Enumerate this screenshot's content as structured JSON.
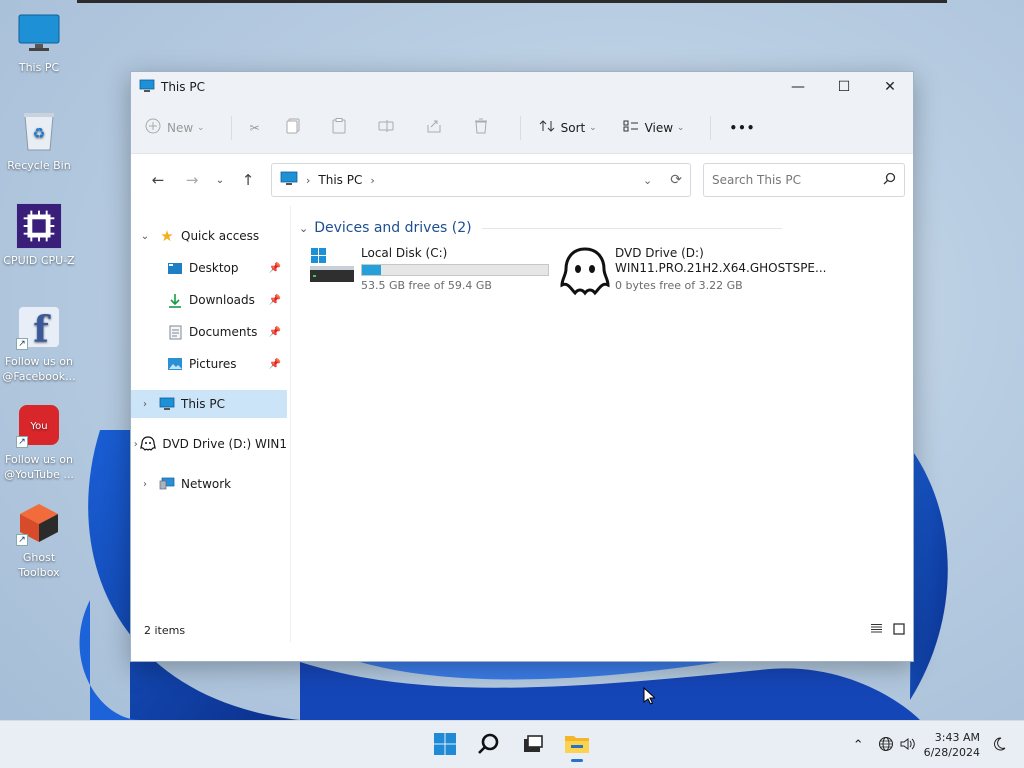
{
  "desktop": {
    "icons": [
      {
        "label": "This PC",
        "icon": "monitor-icon"
      },
      {
        "label": "Recycle Bin",
        "icon": "recycle-bin-icon"
      },
      {
        "label": "CPUID CPU-Z",
        "icon": "cpu-z-icon"
      },
      {
        "label": "Follow us on @Facebook...",
        "icon": "facebook-icon"
      },
      {
        "label": "Follow us on @YouTube ...",
        "icon": "youtube-icon"
      },
      {
        "label": "Ghost Toolbox",
        "icon": "ghost-toolbox-icon"
      }
    ]
  },
  "window": {
    "title": "This PC",
    "toolbar": {
      "new_label": "New",
      "sort_label": "Sort",
      "view_label": "View",
      "more_label": "•••"
    },
    "address": {
      "crumb": "This PC",
      "search_placeholder": "Search This PC"
    },
    "nav": {
      "quick_access": "Quick access",
      "items": [
        {
          "label": "Desktop",
          "icon": "desktop-icon"
        },
        {
          "label": "Downloads",
          "icon": "downloads-icon"
        },
        {
          "label": "Documents",
          "icon": "documents-icon"
        },
        {
          "label": "Pictures",
          "icon": "pictures-icon"
        }
      ],
      "this_pc": "This PC",
      "dvd": "DVD Drive (D:) WIN1",
      "network": "Network"
    },
    "group_header": "Devices and drives (2)",
    "drives": [
      {
        "name": "Local Disk (C:)",
        "free_text": "53.5 GB free of 59.4 GB",
        "used_fraction": 0.1
      },
      {
        "name": "DVD Drive (D:)",
        "volume": "WIN11.PRO.21H2.X64.GHOSTSPE...",
        "free_text": "0 bytes free of 3.22 GB"
      }
    ],
    "status": "2 items"
  },
  "taskbar": {
    "time": "3:43 AM",
    "date": "6/28/2024"
  },
  "colors": {
    "accent": "#26a0da",
    "selection": "#cce4f7",
    "group_header": "#1f4f8f"
  }
}
